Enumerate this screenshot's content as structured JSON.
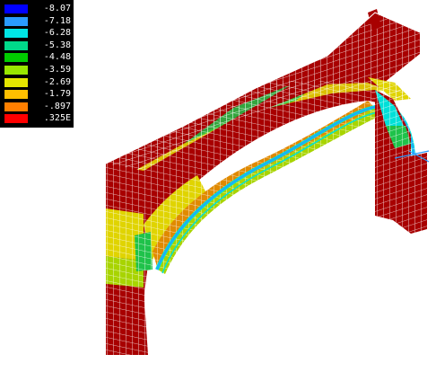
{
  "legend": {
    "entries": [
      {
        "label": "-8.07",
        "color": "#0000ff"
      },
      {
        "label": "-7.18",
        "color": "#2a9cff"
      },
      {
        "label": "-6.28",
        "color": "#00e6e6"
      },
      {
        "label": "-5.38",
        "color": "#00d98a"
      },
      {
        "label": "-4.48",
        "color": "#00cc00"
      },
      {
        "label": "-3.59",
        "color": "#99e600"
      },
      {
        "label": "-2.69",
        "color": "#e6e600"
      },
      {
        "label": "-1.79",
        "color": "#ffbf00"
      },
      {
        "label": "-.897",
        "color": "#ff7f00"
      },
      {
        "label": ".325E",
        "color": "#ff0000"
      }
    ]
  },
  "model": {
    "body_color": "#a80000",
    "mesh_color": "#ffffff",
    "zone_colors": {
      "blue": "#2a9cff",
      "cyan": "#00e0d8",
      "green": "#1fc24a",
      "yellow_green": "#a8d400",
      "yellow": "#e0d400",
      "orange": "#e08a00",
      "dark_red": "#a80000"
    }
  }
}
